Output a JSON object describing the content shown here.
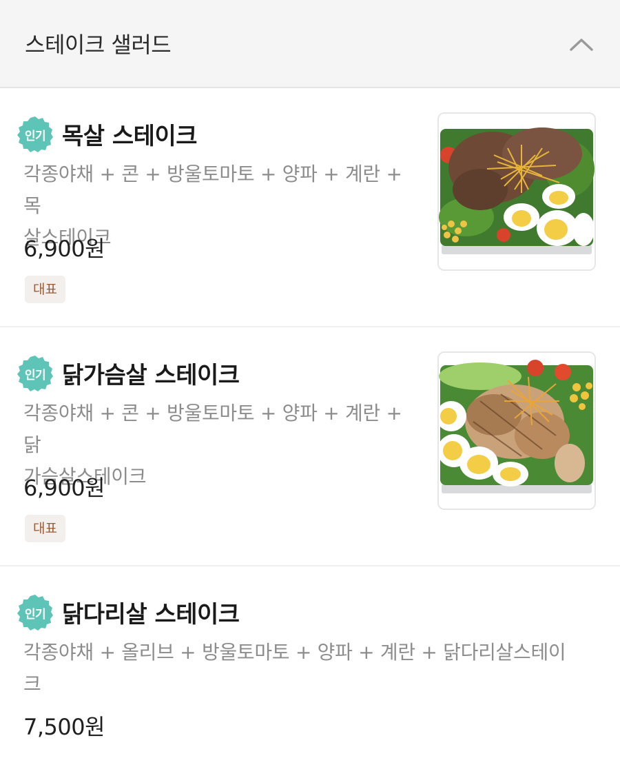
{
  "section": {
    "title": "스테이크 샐러드",
    "collapse_icon": "chevron-up-icon"
  },
  "items": [
    {
      "badge": "인기",
      "name": "목살 스테이크",
      "desc_line1": "각종야채 + 콘 + 방울토마토 + 양파 + 계란 + 목",
      "desc_line2": "살스테이크",
      "price": "6,900원",
      "tag": "대표",
      "image_icon": "pork-neck-steak-salad-photo"
    },
    {
      "badge": "인기",
      "name": "닭가슴살 스테이크",
      "desc_line1": "각종야채 + 콘 + 방울토마토 + 양파 + 계란 + 닭",
      "desc_line2": "가슴살스테이크",
      "price": "6,900원",
      "tag": "대표",
      "image_icon": "chicken-breast-steak-salad-photo"
    },
    {
      "badge": "인기",
      "name": "닭다리살 스테이크",
      "desc_line1": "각종야채 + 올리브 + 방울토마토 + 양파 + 계란 + 닭다리살스테이",
      "desc_line2": "크",
      "price": "7,500원"
    }
  ],
  "colors": {
    "badge_teal": "#5fc4b8",
    "tag_bg": "#f2efec",
    "tag_text": "#9a5a35",
    "header_bg": "#f5f5f5"
  }
}
